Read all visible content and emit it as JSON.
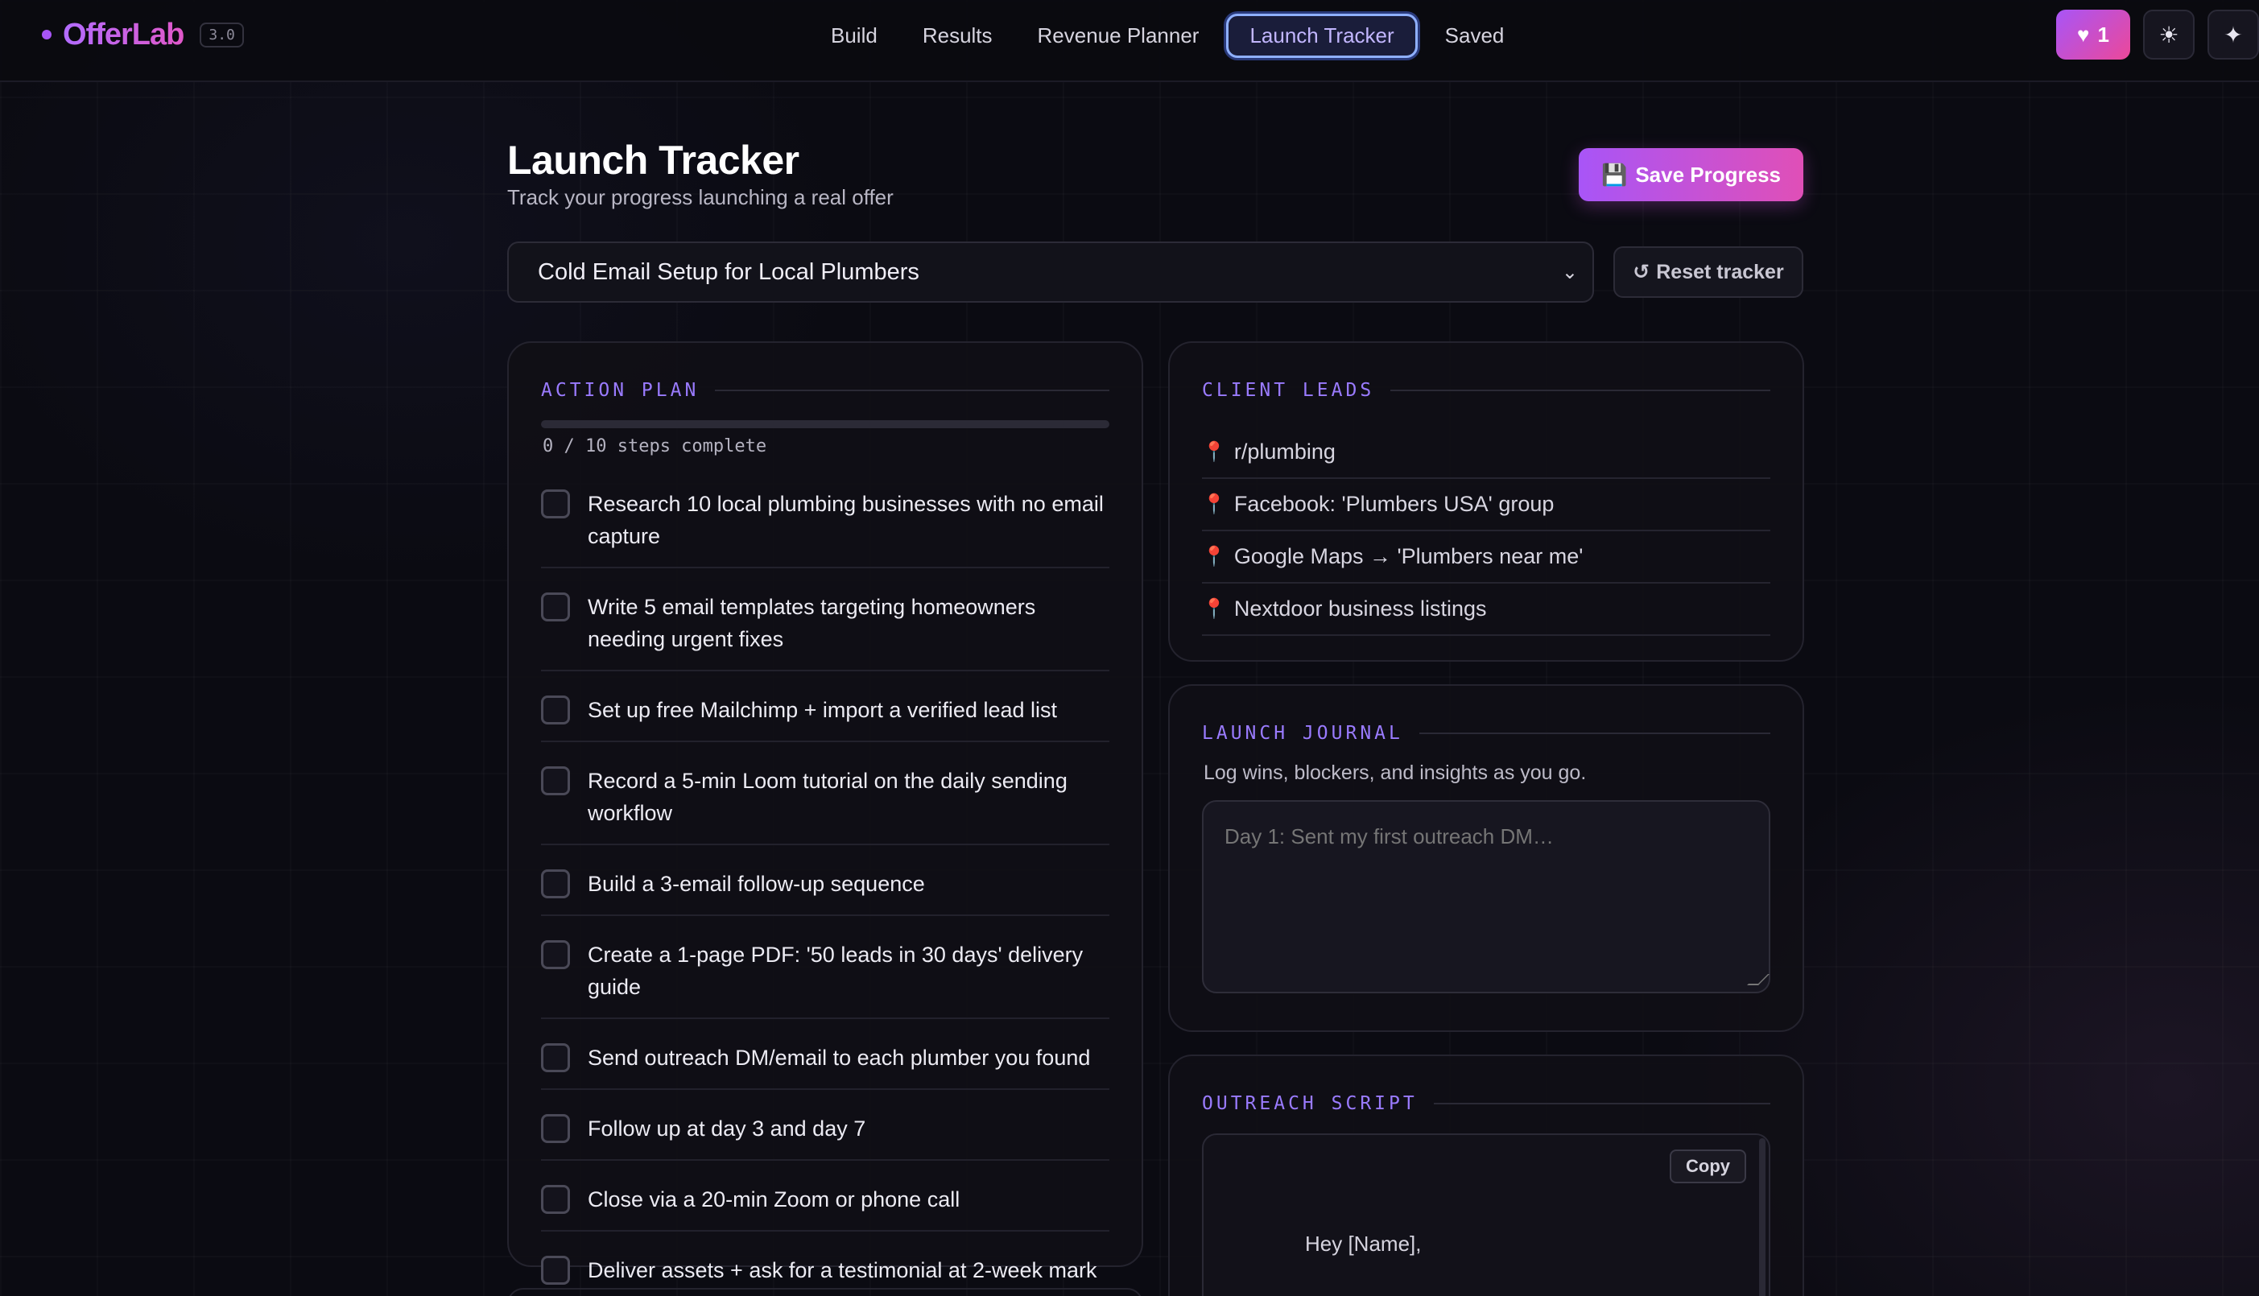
{
  "app": {
    "name": "OfferLab",
    "version": "3.0"
  },
  "nav": {
    "items": [
      {
        "label": "Build",
        "active": false
      },
      {
        "label": "Results",
        "active": false
      },
      {
        "label": "Revenue Planner",
        "active": false
      },
      {
        "label": "Launch Tracker",
        "active": true
      },
      {
        "label": "Saved",
        "active": false
      }
    ]
  },
  "toolbar": {
    "favorites_count": "1",
    "theme_icon": "sun-icon",
    "sparkle_icon": "sparkle-icon"
  },
  "header": {
    "title": "Launch Tracker",
    "subtitle": "Track your progress launching a real offer",
    "save_label": "Save Progress",
    "save_icon": "💾"
  },
  "offer_select": {
    "selected": "Cold Email Setup for Local Plumbers"
  },
  "reset": {
    "icon": "↺",
    "label": "Reset tracker"
  },
  "action_plan": {
    "heading": "ACTION PLAN",
    "progress_text": "0 / 10 steps complete",
    "progress_fraction": 0,
    "steps": [
      {
        "label": "Research 10 local plumbing businesses with no email capture",
        "checked": false
      },
      {
        "label": "Write 5 email templates targeting homeowners needing urgent fixes",
        "checked": false
      },
      {
        "label": "Set up free Mailchimp + import a verified lead list",
        "checked": false
      },
      {
        "label": "Record a 5-min Loom tutorial on the daily sending workflow",
        "checked": false
      },
      {
        "label": "Build a 3-email follow-up sequence",
        "checked": false
      },
      {
        "label": "Create a 1-page PDF: '50 leads in 30 days' delivery guide",
        "checked": false
      },
      {
        "label": "Send outreach DM/email to each plumber you found",
        "checked": false
      },
      {
        "label": "Follow up at day 3 and day 7",
        "checked": false
      },
      {
        "label": "Close via a 20-min Zoom or phone call",
        "checked": false
      },
      {
        "label": "Deliver assets + ask for a testimonial at 2-week mark",
        "checked": false
      }
    ]
  },
  "client_leads": {
    "heading": "CLIENT LEADS",
    "items": [
      "r/plumbing",
      "Facebook: 'Plumbers USA' group",
      "Google Maps → 'Plumbers near me'",
      "Nextdoor business listings"
    ]
  },
  "journal": {
    "heading": "LAUNCH JOURNAL",
    "hint": "Log wins, blockers, and insights as you go.",
    "placeholder": "Day 1: Sent my first outreach DM…",
    "value": ""
  },
  "outreach": {
    "heading": "OUTREACH SCRIPT",
    "copy_label": "Copy",
    "script_first_line": "Hey [Name],"
  },
  "colors": {
    "accent_purple": "#a855f7",
    "accent_pink": "#ec4899",
    "background": "#0b0b12"
  }
}
